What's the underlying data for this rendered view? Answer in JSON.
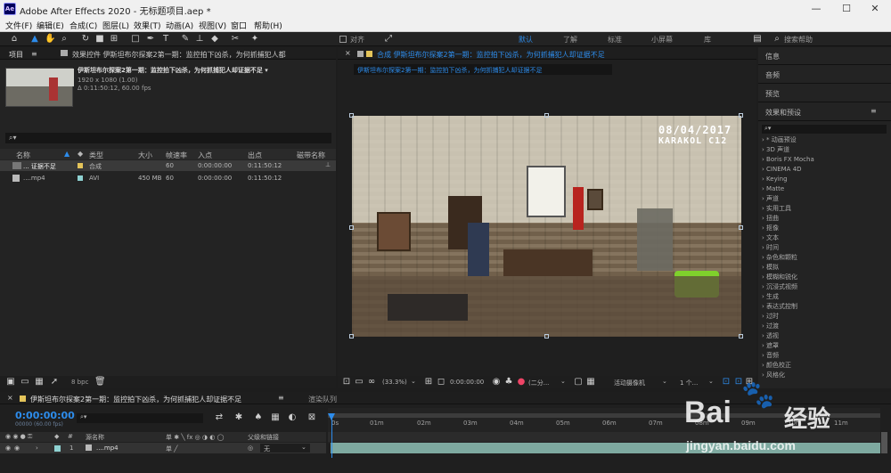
{
  "window": {
    "title": "Adobe After Effects 2020 - 无标题项目.aep *",
    "app_icon": "Ae",
    "minimize": "—",
    "maximize": "☐",
    "close": "✕"
  },
  "menu": [
    "文件(F)",
    "编辑(E)",
    "合成(C)",
    "图层(L)",
    "效果(T)",
    "动画(A)",
    "视图(V)",
    "窗口",
    "帮助(H)"
  ],
  "toolbar": {
    "align_label": "对齐",
    "workspaces": [
      "默认",
      "了解",
      "标准",
      "小屏幕",
      "库"
    ],
    "search_placeholder": "搜索帮助"
  },
  "project_panel": {
    "tab": "项目",
    "effects_tab": "效果控件 伊斯坦布尔探案2第一期：监控拍下凶杀，为何抓捕犯人都",
    "item_title": "伊斯坦布尔探案2第一期：监控拍下凶杀，为何抓捕犯人却证据不足 ▾",
    "item_dims": "1920 x 1080 (1.00)",
    "item_duration": "Δ 0:11:50:12, 60.00 fps",
    "search_icon": "⌕▾",
    "columns": [
      "名称",
      "类型",
      "大小",
      "帧速率",
      "入点",
      "出点",
      "磁带名称"
    ],
    "rows": [
      {
        "name": "... 证据不足",
        "type": "合成",
        "size": "",
        "fps": "60",
        "in": "0:00:00:00",
        "out": "0:11:50:12"
      },
      {
        "name": "....mp4",
        "type": "AVI",
        "size": "450 MB",
        "fps": "60",
        "in": "0:00:00:00",
        "out": "0:11:50:12"
      }
    ],
    "bpc": "8 bpc"
  },
  "composition": {
    "tab": "合成 伊斯坦布尔探案2第一期：监控拍下凶杀，为何抓捕犯人却证据不足",
    "breadcrumb": "伊斯坦布尔探案2第一期：监控拍下凶杀，为何抓捕犯人却证据不足",
    "overlay_date": "08/04/2017",
    "overlay_cam": "KARAKOL C12",
    "zoom": "(33.3%)",
    "timecode": "0:00:00:00",
    "resolution": "(二分...",
    "camera": "活动摄像机",
    "views": "1 个..."
  },
  "right_panels": {
    "info": "信息",
    "audio": "音频",
    "preview": "预览",
    "effects": "效果和预设",
    "list": [
      "* 动画预设",
      "3D 声道",
      "Boris FX Mocha",
      "CINEMA 4D",
      "Keying",
      "Matte",
      "声道",
      "实用工具",
      "扭曲",
      "抠像",
      "文本",
      "时间",
      "杂色和颗粒",
      "模拟",
      "模糊和锐化",
      "沉浸式视频",
      "生成",
      "表达式控制",
      "过时",
      "过渡",
      "透视",
      "遮罩",
      "音频",
      "颜色校正",
      "风格化"
    ]
  },
  "timeline": {
    "tab": "伊斯坦布尔探案2第一期：监控拍下凶杀，为何抓捕犯人却证据不足",
    "render_queue": "渲染队列",
    "timecode": "0:00:00:00",
    "fps_note": "00000 (60.00 fps)",
    "col_source": "源名称",
    "col_parent": "父级和链接",
    "layer_num": "1",
    "layer_name": "....mp4",
    "parent_value": "无",
    "ruler": [
      "0s",
      "01m",
      "02m",
      "03m",
      "04m",
      "05m",
      "06m",
      "07m",
      "08m",
      "09m",
      "10m",
      "11m"
    ]
  },
  "watermark": {
    "brand": "Bai",
    "brand2": "经验",
    "url": "jingyan.baidu.com"
  }
}
